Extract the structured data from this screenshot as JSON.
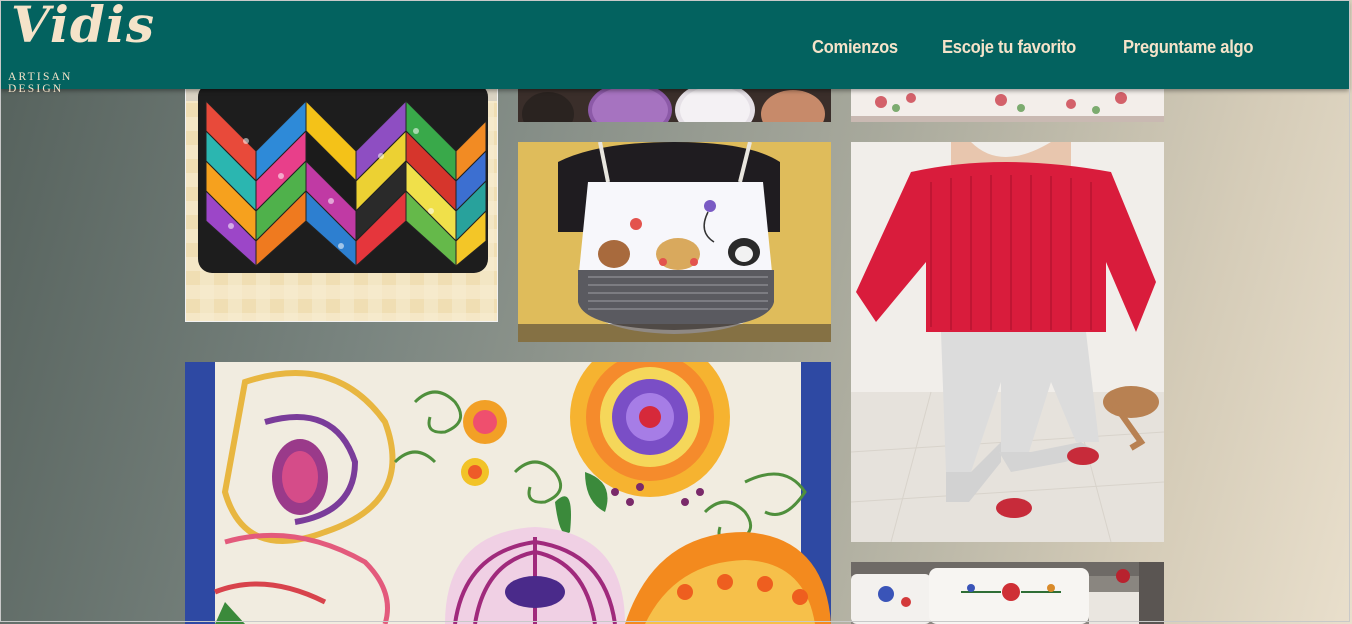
{
  "brand": {
    "name": "Vidis",
    "tagline": "ARTISAN DESIGN"
  },
  "nav": {
    "items": [
      {
        "label": "Comienzos"
      },
      {
        "label": "Escoje tu favorito"
      },
      {
        "label": "Preguntame algo"
      }
    ]
  },
  "gallery": {
    "items": [
      {
        "subject": "patchwork-chevron-pillow"
      },
      {
        "subject": "yarn-spools"
      },
      {
        "subject": "embroidered-pillow-top"
      },
      {
        "subject": "dog-applique-apron"
      },
      {
        "subject": "red-knit-sweater"
      },
      {
        "subject": "floral-embroidery"
      },
      {
        "subject": "embroidered-pillows-bed"
      }
    ]
  },
  "colors": {
    "header": "#03625f",
    "brand_text": "#f5e3c9"
  }
}
